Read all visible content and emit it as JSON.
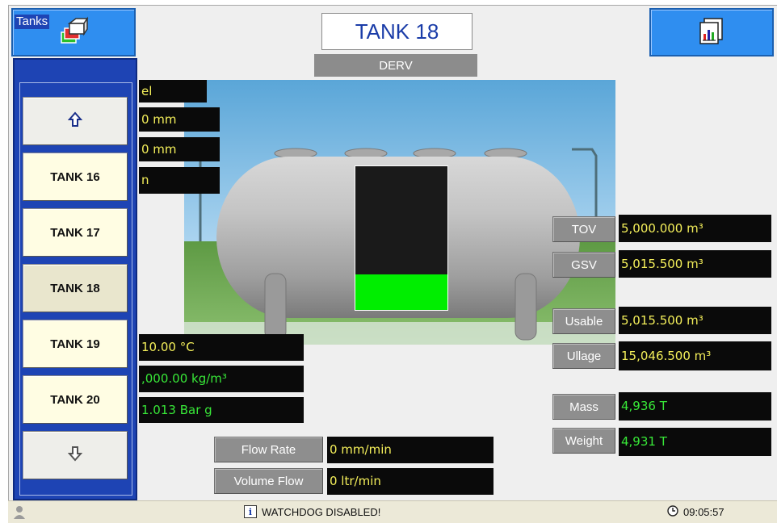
{
  "header": {
    "tank_title": "TANK 18",
    "product": "DERV",
    "home_icon": "tanks-overview-icon",
    "report_icon": "report-icon"
  },
  "tanks": {
    "legend": "Tanks",
    "up_icon": "arrow-up-icon",
    "down_icon": "arrow-down-icon",
    "items": [
      {
        "label": "TANK 16"
      },
      {
        "label": "TANK 17"
      },
      {
        "label": "TANK 18"
      },
      {
        "label": "TANK 19"
      },
      {
        "label": "TANK 20"
      }
    ],
    "selected": "TANK 18"
  },
  "left_readouts": {
    "level_units": "el",
    "level1": "0 mm",
    "level2": "0 mm",
    "level3": "n",
    "temperature": "10.00 °C",
    "density": ",000.00 kg/m³",
    "pressure": "1.013 Bar g"
  },
  "gauge": {
    "fill_fraction": 0.25,
    "fill_color": "#00ee00"
  },
  "flow": {
    "flow_rate_label": "Flow Rate",
    "flow_rate_value": "0 mm/min",
    "volume_flow_label": "Volume Flow",
    "volume_flow_value": "0 ltr/min"
  },
  "right_readouts": {
    "tov_label": "TOV",
    "tov_value": "5,000.000 m³",
    "gsv_label": "GSV",
    "gsv_value": "5,015.500 m³",
    "usable_label": "Usable",
    "usable_value": "5,015.500 m³",
    "ullage_label": "Ullage",
    "ullage_value": "15,046.500 m³",
    "mass_label": "Mass",
    "mass_value": "4,936 T",
    "weight_label": "Weight",
    "weight_value": "4,931 T"
  },
  "status": {
    "message": "WATCHDOG DISABLED!",
    "info_icon": "info-icon",
    "time": "09:05:57",
    "clock_icon": "clock-icon",
    "user_icon": "user-icon"
  },
  "colors": {
    "accent_blue": "#2f8ef0",
    "panel_blue": "#1e44b4",
    "value_yellow": "#f4ef5a",
    "value_green": "#38e838"
  }
}
